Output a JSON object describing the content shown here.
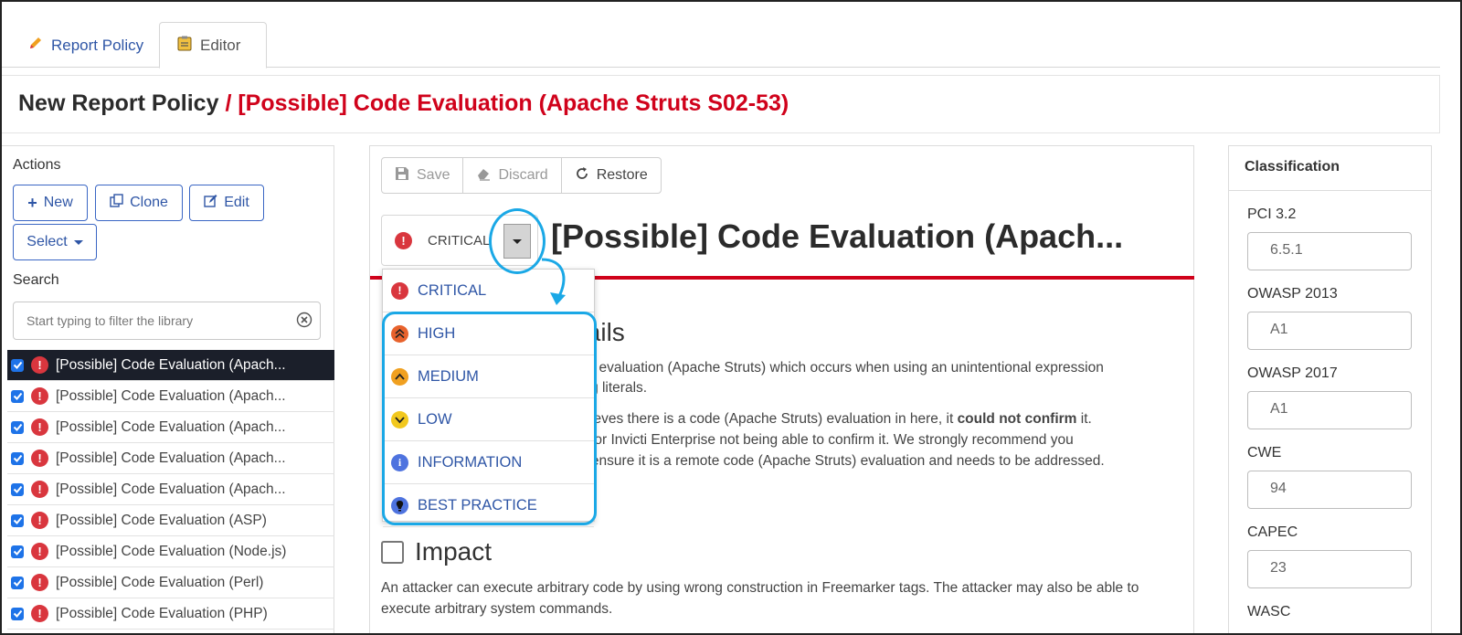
{
  "tabs": [
    {
      "label": "Report Policy",
      "icon": "pencil-icon"
    },
    {
      "label": "Editor",
      "icon": "clipboard-icon"
    }
  ],
  "page_title": {
    "prefix": "New Report Policy",
    "separator": " / ",
    "item": "[Possible] Code Evaluation (Apache Struts S02-53)"
  },
  "actions": {
    "label": "Actions",
    "new": "New",
    "clone": "Clone",
    "edit": "Edit",
    "select": "Select"
  },
  "search": {
    "label": "Search",
    "placeholder": "Start typing to filter the library"
  },
  "library": [
    {
      "label": "[Possible] Code Evaluation (Apach...",
      "selected": true,
      "checked": true
    },
    {
      "label": "[Possible] Code Evaluation (Apach...",
      "selected": false,
      "checked": true
    },
    {
      "label": "[Possible] Code Evaluation (Apach...",
      "selected": false,
      "checked": true
    },
    {
      "label": "[Possible] Code Evaluation (Apach...",
      "selected": false,
      "checked": true
    },
    {
      "label": "[Possible] Code Evaluation (Apach...",
      "selected": false,
      "checked": true
    },
    {
      "label": "[Possible] Code Evaluation (ASP)",
      "selected": false,
      "checked": true
    },
    {
      "label": "[Possible] Code Evaluation (Node.js)",
      "selected": false,
      "checked": true
    },
    {
      "label": "[Possible] Code Evaluation (Perl)",
      "selected": false,
      "checked": true
    },
    {
      "label": "[Possible] Code Evaluation (PHP)",
      "selected": false,
      "checked": true
    }
  ],
  "toolbar": {
    "save": "Save",
    "discard": "Discard",
    "restore": "Restore"
  },
  "severity": {
    "current": "CRITICAL",
    "indicator": "!"
  },
  "vuln_title": "[Possible] Code Evaluation (Apach...",
  "severity_options": [
    {
      "label": "CRITICAL",
      "icon": "critical-icon",
      "color": "#d9363e"
    },
    {
      "label": "HIGH",
      "icon": "high-icon",
      "color": "#e8622c"
    },
    {
      "label": "MEDIUM",
      "icon": "medium-icon",
      "color": "#f0a020"
    },
    {
      "label": "LOW",
      "icon": "low-icon",
      "color": "#f2c81e"
    },
    {
      "label": "INFORMATION",
      "icon": "information-icon",
      "color": "#4e73df"
    },
    {
      "label": "BEST PRACTICE",
      "icon": "best-practice-icon",
      "color": "#4e73df"
    }
  ],
  "details": {
    "heading": "tails",
    "line1": "de evaluation (Apache Struts) which occurs when using an unintentional expression",
    "line2": "ing literals.",
    "line3_pre": "elieves there is a code (Apache Struts) evaluation in here, it ",
    "line3_bold": "could not confirm",
    "line3_post": " it.",
    "line4": "s for Invicti Enterprise not being able to confirm it. We strongly recommend you",
    "line5": "o ensure it is a remote code (Apache Struts) evaluation and needs to be addressed."
  },
  "impact": {
    "heading": "Impact",
    "text": "An attacker can execute arbitrary code by using wrong construction in Freemarker tags. The attacker may also be able to execute arbitrary system commands."
  },
  "classification": {
    "heading": "Classification",
    "fields": [
      {
        "label": "PCI 3.2",
        "value": "6.5.1"
      },
      {
        "label": "OWASP 2013",
        "value": "A1"
      },
      {
        "label": "OWASP 2017",
        "value": "A1"
      },
      {
        "label": "CWE",
        "value": "94"
      },
      {
        "label": "CAPEC",
        "value": "23"
      },
      {
        "label": "WASC",
        "value": ""
      }
    ]
  },
  "colors": {
    "accent": "#2f56a6",
    "critical": "#d9363e",
    "highlight": "#1aa8e6",
    "title_red": "#d0021b"
  }
}
